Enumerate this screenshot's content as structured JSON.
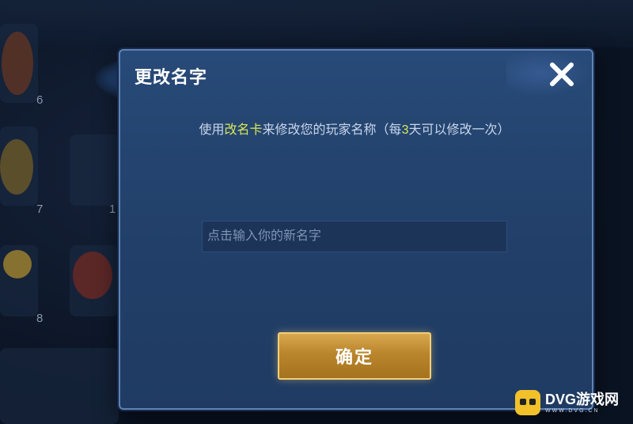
{
  "dialog": {
    "title": "更改名字",
    "description": {
      "part1": "使用",
      "highlight1": "改名卡",
      "part2": "来修改您的玩家名称（每",
      "highlight2": "3",
      "part3": "天可以修改一次）"
    },
    "input": {
      "placeholder": "点击输入你的新名字",
      "value": ""
    },
    "confirm_label": "确定",
    "close_icon": "close-icon"
  },
  "background": {
    "slot_counts": [
      "6",
      "7",
      "1",
      "8"
    ]
  },
  "watermark": {
    "main": "DVG游戏网",
    "sub": "WWW.DVG.CN"
  },
  "colors": {
    "dialog_bg": "#284a78",
    "highlight": "#d8e85a",
    "button_gold": "#c99438",
    "watermark_yellow": "#f2c12a"
  }
}
